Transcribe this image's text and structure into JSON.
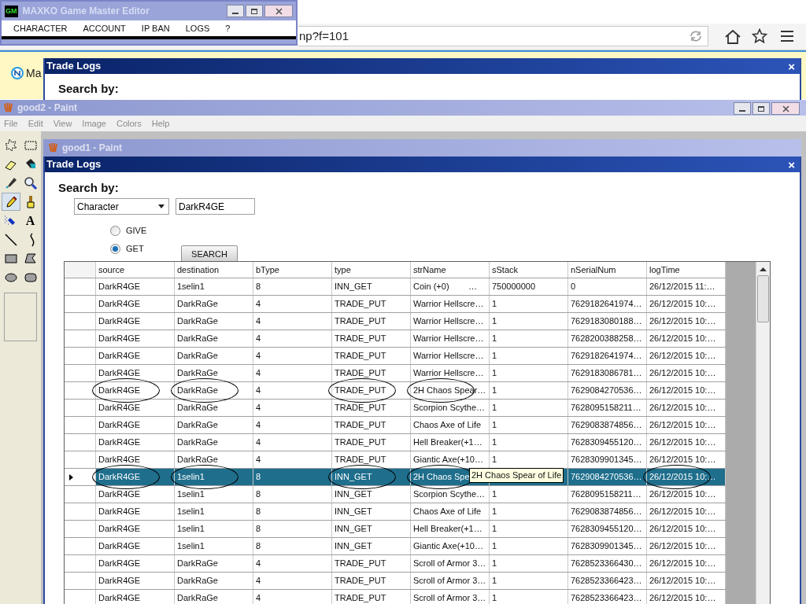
{
  "browser": {
    "address": "np?f=101",
    "tab_text": "Ma"
  },
  "gm_editor": {
    "title": "MAXKO Game Master Editor",
    "icon_label": "GM",
    "menu": [
      "CHARACTER",
      "ACCOUNT",
      "IP BAN",
      "LOGS",
      "?"
    ]
  },
  "back_trade_logs": {
    "title": "Trade Logs",
    "close": "×",
    "search_label": "Search by:"
  },
  "paint_back": {
    "title": "good2 - Paint",
    "menu": [
      "File",
      "Edit",
      "View",
      "Image",
      "Colors",
      "Help"
    ],
    "tools": [
      {
        "kind": "free-select",
        "selected": false
      },
      {
        "kind": "rect-select",
        "selected": false
      },
      {
        "kind": "eraser",
        "selected": false
      },
      {
        "kind": "fill",
        "selected": false
      },
      {
        "kind": "picker",
        "selected": false
      },
      {
        "kind": "magnifier",
        "selected": false
      },
      {
        "kind": "pencil",
        "selected": true
      },
      {
        "kind": "brush",
        "selected": false
      },
      {
        "kind": "airbrush",
        "selected": false
      },
      {
        "kind": "text",
        "selected": false,
        "label": "A"
      },
      {
        "kind": "line",
        "selected": false
      },
      {
        "kind": "curve",
        "selected": false
      },
      {
        "kind": "rectangle",
        "selected": false
      },
      {
        "kind": "polygon",
        "selected": false
      },
      {
        "kind": "ellipse",
        "selected": false
      },
      {
        "kind": "rounded-rect",
        "selected": false
      }
    ]
  },
  "paint_front": {
    "title": "good1 - Paint"
  },
  "trade_logs": {
    "title": "Trade Logs",
    "close": "×",
    "search_label": "Search by:",
    "search_by": {
      "value": "Character"
    },
    "query": {
      "value": "DarkR4GE"
    },
    "radios": [
      {
        "label": "GIVE",
        "selected": false
      },
      {
        "label": "GET",
        "selected": true
      }
    ],
    "search_button": "SEARCH",
    "table": {
      "columns": [
        "source",
        "destination",
        "bType",
        "type",
        "strName",
        "sStack",
        "nSerialNum",
        "logTime"
      ],
      "tooltip": "2H Chaos Spear of Life",
      "rows": [
        {
          "selected": false,
          "cells": [
            "DarkR4GE",
            "1selin1",
            "8",
            "INN_GET",
            "Coin (+0)        …",
            "750000000",
            "0",
            "26/12/2015 11:…"
          ],
          "circled": [
            false,
            false,
            false,
            false,
            false,
            false,
            false,
            false
          ]
        },
        {
          "selected": false,
          "cells": [
            "DarkR4GE",
            "DarkRaGe",
            "4",
            "TRADE_PUT",
            "Warrior Hellscre…",
            "1",
            "7629182641974…",
            "26/12/2015 10:…"
          ],
          "circled": [
            false,
            false,
            false,
            false,
            false,
            false,
            false,
            false
          ]
        },
        {
          "selected": false,
          "cells": [
            "DarkR4GE",
            "DarkRaGe",
            "4",
            "TRADE_PUT",
            "Warrior Hellscre…",
            "1",
            "7629183080188…",
            "26/12/2015 10:…"
          ],
          "circled": [
            false,
            false,
            false,
            false,
            false,
            false,
            false,
            false
          ]
        },
        {
          "selected": false,
          "cells": [
            "DarkR4GE",
            "DarkRaGe",
            "4",
            "TRADE_PUT",
            "Warrior Hellscre…",
            "1",
            "7628200388258…",
            "26/12/2015 10:…"
          ],
          "circled": [
            false,
            false,
            false,
            false,
            false,
            false,
            false,
            false
          ]
        },
        {
          "selected": false,
          "cells": [
            "DarkR4GE",
            "DarkRaGe",
            "4",
            "TRADE_PUT",
            "Warrior Hellscre…",
            "1",
            "7629182641974…",
            "26/12/2015 10:…"
          ],
          "circled": [
            false,
            false,
            false,
            false,
            false,
            false,
            false,
            false
          ]
        },
        {
          "selected": false,
          "cells": [
            "DarkR4GE",
            "DarkRaGe",
            "4",
            "TRADE_PUT",
            "Warrior Hellscre…",
            "1",
            "7629183086781…",
            "26/12/2015 10:…"
          ],
          "circled": [
            false,
            false,
            false,
            false,
            false,
            false,
            false,
            false
          ]
        },
        {
          "selected": false,
          "cells": [
            "DarkR4GE",
            "DarkRaGe",
            "4",
            "TRADE_PUT",
            "2H Chaos Spear…",
            "1",
            "7629084270536…",
            "26/12/2015 10:…"
          ],
          "circled": [
            true,
            true,
            false,
            true,
            true,
            false,
            false,
            false
          ]
        },
        {
          "selected": false,
          "cells": [
            "DarkR4GE",
            "DarkRaGe",
            "4",
            "TRADE_PUT",
            "Scorpion Scythe…",
            "1",
            "7628095158211…",
            "26/12/2015 10:…"
          ],
          "circled": [
            false,
            false,
            false,
            false,
            false,
            false,
            false,
            false
          ]
        },
        {
          "selected": false,
          "cells": [
            "DarkR4GE",
            "DarkRaGe",
            "4",
            "TRADE_PUT",
            "Chaos Axe of Life",
            "1",
            "7629083874856…",
            "26/12/2015 10:…"
          ],
          "circled": [
            false,
            false,
            false,
            false,
            false,
            false,
            false,
            false
          ]
        },
        {
          "selected": false,
          "cells": [
            "DarkR4GE",
            "DarkRaGe",
            "4",
            "TRADE_PUT",
            "Hell Breaker(+1…",
            "1",
            "7628309455120…",
            "26/12/2015 10:…"
          ],
          "circled": [
            false,
            false,
            false,
            false,
            false,
            false,
            false,
            false
          ]
        },
        {
          "selected": false,
          "cells": [
            "DarkR4GE",
            "DarkRaGe",
            "4",
            "TRADE_PUT",
            "Giantic Axe(+10…",
            "1",
            "7628309901345…",
            "26/12/2015 10:…"
          ],
          "circled": [
            false,
            false,
            false,
            false,
            false,
            false,
            false,
            false
          ]
        },
        {
          "selected": true,
          "cells": [
            "DarkR4GE",
            "1selin1",
            "8",
            "INN_GET",
            "2H Chaos Spe",
            null,
            "7629084270536…",
            "26/12/2015 10:…"
          ],
          "circled": [
            true,
            true,
            false,
            true,
            true,
            false,
            false,
            true
          ]
        },
        {
          "selected": false,
          "cells": [
            "DarkR4GE",
            "1selin1",
            "8",
            "INN_GET",
            "Scorpion Scythe…",
            "1",
            "7628095158211…",
            "26/12/2015 10:…"
          ],
          "circled": [
            false,
            false,
            false,
            false,
            false,
            false,
            false,
            false
          ]
        },
        {
          "selected": false,
          "cells": [
            "DarkR4GE",
            "1selin1",
            "8",
            "INN_GET",
            "Chaos Axe of Life",
            "1",
            "7629083874856…",
            "26/12/2015 10:…"
          ],
          "circled": [
            false,
            false,
            false,
            false,
            false,
            false,
            false,
            false
          ]
        },
        {
          "selected": false,
          "cells": [
            "DarkR4GE",
            "1selin1",
            "8",
            "INN_GET",
            "Hell Breaker(+1…",
            "1",
            "7628309455120…",
            "26/12/2015 10:…"
          ],
          "circled": [
            false,
            false,
            false,
            false,
            false,
            false,
            false,
            false
          ]
        },
        {
          "selected": false,
          "cells": [
            "DarkR4GE",
            "1selin1",
            "8",
            "INN_GET",
            "Giantic Axe(+10…",
            "1",
            "7628309901345…",
            "26/12/2015 10:…"
          ],
          "circled": [
            false,
            false,
            false,
            false,
            false,
            false,
            false,
            false
          ]
        },
        {
          "selected": false,
          "cells": [
            "DarkR4GE",
            "DarkRaGe",
            "4",
            "TRADE_PUT",
            "Scroll of Armor 3…",
            "1",
            "7628523366430…",
            "26/12/2015 10:…"
          ],
          "circled": [
            false,
            false,
            false,
            false,
            false,
            false,
            false,
            false
          ]
        },
        {
          "selected": false,
          "cells": [
            "DarkR4GE",
            "DarkRaGe",
            "4",
            "TRADE_PUT",
            "Scroll of Armor 3…",
            "1",
            "7628523366423…",
            "26/12/2015 10:…"
          ],
          "circled": [
            false,
            false,
            false,
            false,
            false,
            false,
            false,
            false
          ]
        },
        {
          "selected": false,
          "cells": [
            "DarkR4GE",
            "DarkRaGe",
            "4",
            "TRADE_PUT",
            "Scroll of Armor 3…",
            "1",
            "7628523366423…",
            "26/12/2015 10:…"
          ],
          "circled": [
            false,
            false,
            false,
            false,
            false,
            false,
            false,
            false
          ]
        }
      ]
    }
  }
}
